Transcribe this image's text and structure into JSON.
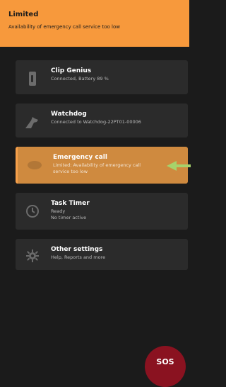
{
  "banner": {
    "title": "Limited",
    "subtitle": "Availability of emergency call service too low"
  },
  "cards": [
    {
      "label": "Clip Genius",
      "meta_lines": [
        "Connected, Battery 89 %"
      ],
      "icon": "device-battery-icon"
    },
    {
      "label": "Watchdog",
      "meta_lines": [
        "Connected to Watchdog-22PT01-00006"
      ],
      "icon": "dog-icon"
    },
    {
      "label": "Emergency call",
      "meta_lines": [
        "Limited: Availability of emergency call",
        "service too low"
      ],
      "icon": "emergency-icon",
      "status": "active"
    },
    {
      "label": "Task Timer",
      "meta_lines": [
        "Ready",
        "No timer active"
      ],
      "icon": "clock-icon"
    },
    {
      "label": "Other settings",
      "meta_lines": [
        "Help, Reports and more"
      ],
      "icon": "gear-icon"
    }
  ],
  "sos": {
    "label": "SOS"
  },
  "colors": {
    "banner": "#f7993c",
    "active_card": "#cf8a3f",
    "sos": "#8a1220",
    "pointer": "#a6d26b"
  }
}
